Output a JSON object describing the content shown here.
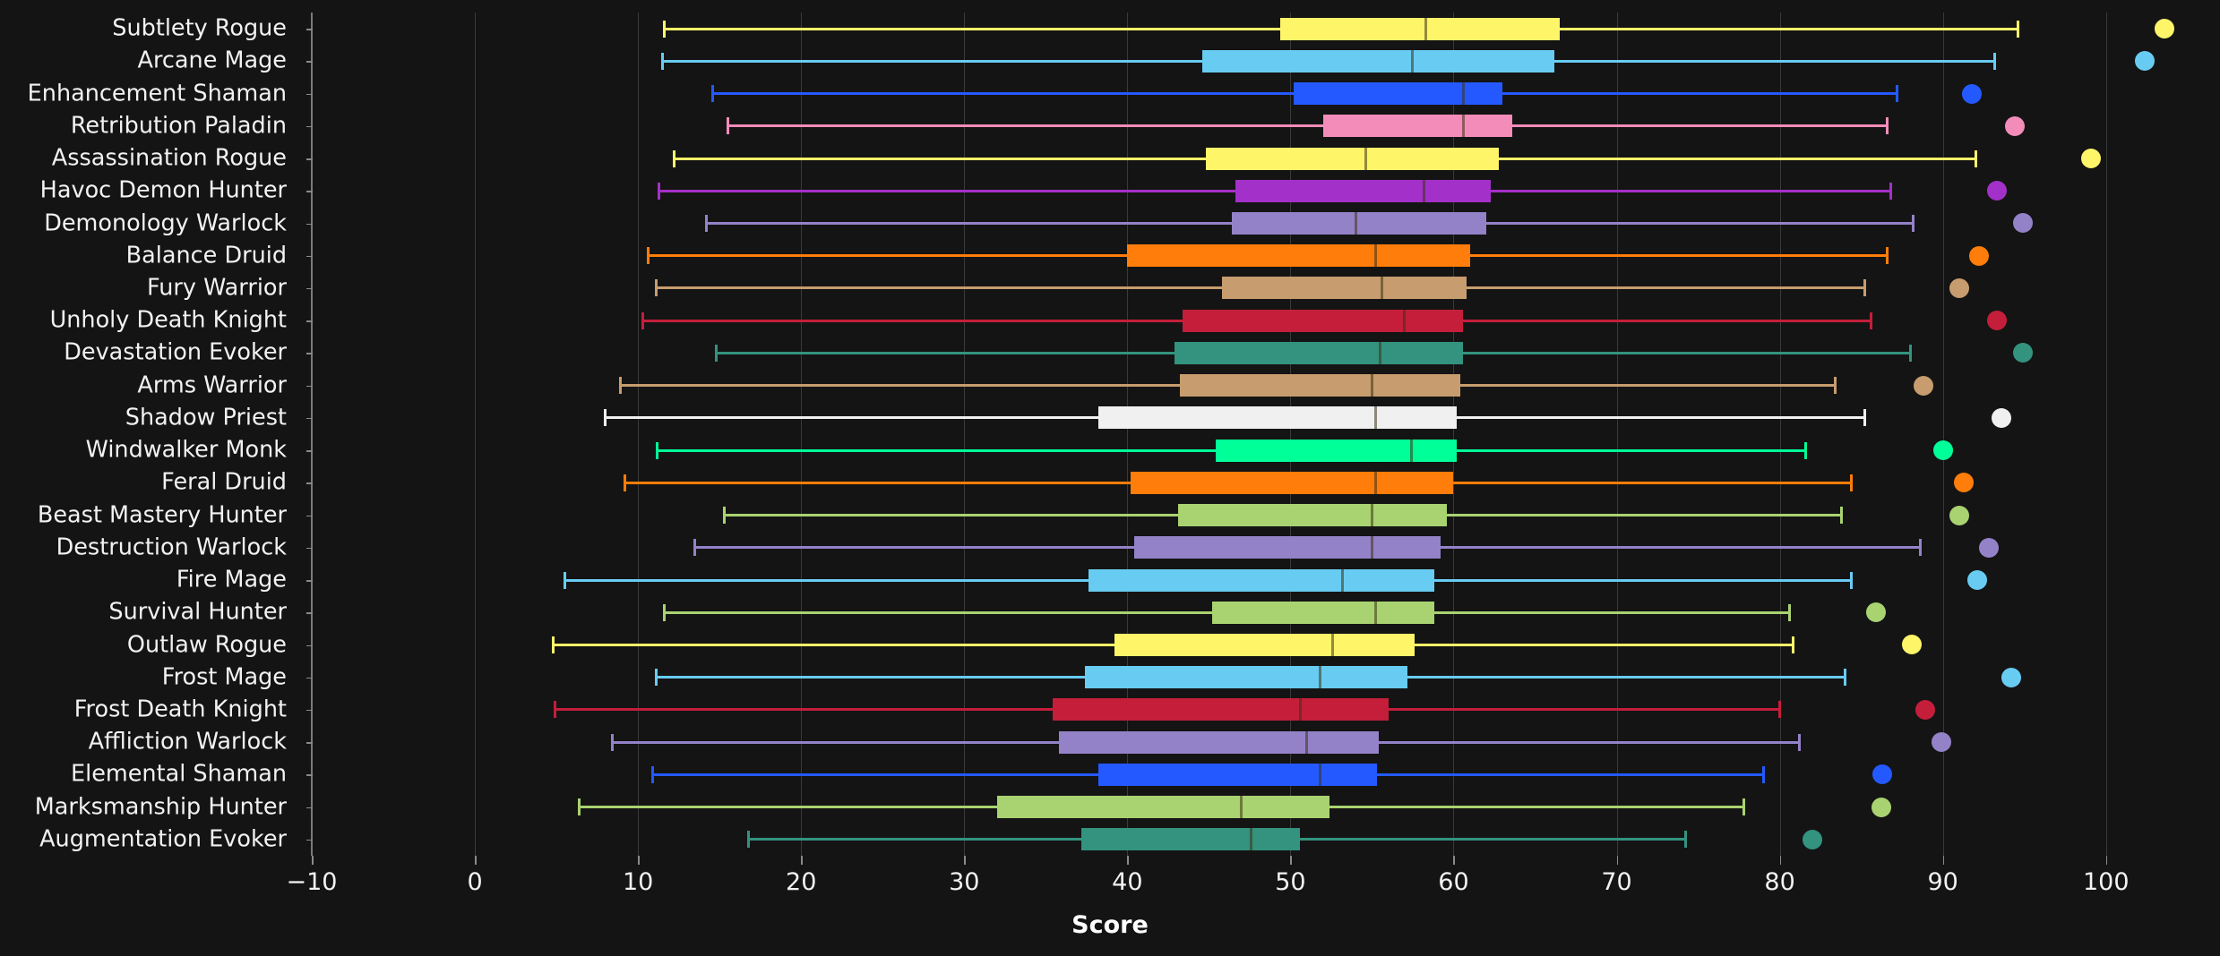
{
  "chart_data": {
    "type": "box",
    "title": "",
    "xlabel": "Score",
    "ylabel": "",
    "xlim": [
      -10,
      106
    ],
    "xticks": [
      -10,
      0,
      10,
      20,
      30,
      40,
      50,
      60,
      70,
      80,
      90,
      100
    ],
    "xtick_labels": [
      "−10",
      "0",
      "10",
      "20",
      "30",
      "40",
      "50",
      "60",
      "70",
      "80",
      "90",
      "100"
    ],
    "grid": "vertical",
    "legend": "none",
    "background": "#141414",
    "categories": [
      "Subtlety Rogue",
      "Arcane Mage",
      "Enhancement Shaman",
      "Retribution Paladin",
      "Assassination Rogue",
      "Havoc Demon Hunter",
      "Demonology Warlock",
      "Balance Druid",
      "Fury Warrior",
      "Unholy Death Knight",
      "Devastation Evoker",
      "Arms Warrior",
      "Shadow Priest",
      "Windwalker Monk",
      "Feral Druid",
      "Beast Mastery Hunter",
      "Destruction Warlock",
      "Fire Mage",
      "Survival Hunter",
      "Outlaw Rogue",
      "Frost Mage",
      "Frost Death Knight",
      "Affliction Warlock",
      "Elemental Shaman",
      "Marksmanship Hunter",
      "Augmentation Evoker"
    ],
    "boxes": [
      {
        "label": "Subtlety Rogue",
        "color": "#fff569",
        "whisker_low": 11.6,
        "q1": 49.4,
        "median": 58.3,
        "q3": 66.5,
        "whisker_high": 94.6,
        "outliers": [
          103.6
        ]
      },
      {
        "label": "Arcane Mage",
        "color": "#68ccf2",
        "whisker_low": 11.5,
        "q1": 44.6,
        "median": 57.5,
        "q3": 66.2,
        "whisker_high": 93.2,
        "outliers": [
          102.4
        ]
      },
      {
        "label": "Enhancement Shaman",
        "color": "#2459ff",
        "whisker_low": 14.6,
        "q1": 50.2,
        "median": 60.6,
        "q3": 63.0,
        "whisker_high": 87.2,
        "outliers": [
          91.8
        ]
      },
      {
        "label": "Retribution Paladin",
        "color": "#f48cba",
        "whisker_low": 15.5,
        "q1": 52.0,
        "median": 60.6,
        "q3": 63.6,
        "whisker_high": 86.6,
        "outliers": [
          94.4
        ]
      },
      {
        "label": "Assassination Rogue",
        "color": "#fff569",
        "whisker_low": 12.2,
        "q1": 44.8,
        "median": 54.6,
        "q3": 62.8,
        "whisker_high": 92.0,
        "outliers": [
          99.1
        ]
      },
      {
        "label": "Havoc Demon Hunter",
        "color": "#a330c9",
        "whisker_low": 11.3,
        "q1": 46.6,
        "median": 58.2,
        "q3": 62.3,
        "whisker_high": 86.8,
        "outliers": [
          93.3
        ]
      },
      {
        "label": "Demonology Warlock",
        "color": "#9482c9",
        "whisker_low": 14.2,
        "q1": 46.4,
        "median": 54.0,
        "q3": 62.0,
        "whisker_high": 88.2,
        "outliers": [
          94.9
        ]
      },
      {
        "label": "Balance Druid",
        "color": "#ff7d0a",
        "whisker_low": 10.6,
        "q1": 40.0,
        "median": 55.2,
        "q3": 61.0,
        "whisker_high": 86.6,
        "outliers": [
          92.2
        ]
      },
      {
        "label": "Fury Warrior",
        "color": "#c79c6e",
        "whisker_low": 11.1,
        "q1": 45.8,
        "median": 55.6,
        "q3": 60.8,
        "whisker_high": 85.2,
        "outliers": [
          91.0
        ]
      },
      {
        "label": "Unholy Death Knight",
        "color": "#c41e3b",
        "whisker_low": 10.3,
        "q1": 43.4,
        "median": 57.0,
        "q3": 60.6,
        "whisker_high": 85.6,
        "outliers": [
          93.3
        ]
      },
      {
        "label": "Devastation Evoker",
        "color": "#33937f",
        "whisker_low": 14.8,
        "q1": 42.9,
        "median": 55.5,
        "q3": 60.6,
        "whisker_high": 88.0,
        "outliers": [
          94.9
        ]
      },
      {
        "label": "Arms Warrior",
        "color": "#c79c6e",
        "whisker_low": 8.9,
        "q1": 43.2,
        "median": 55.0,
        "q3": 60.4,
        "whisker_high": 83.4,
        "outliers": [
          88.8
        ]
      },
      {
        "label": "Shadow Priest",
        "color": "#f0f0f0",
        "whisker_low": 8.0,
        "q1": 38.2,
        "median": 55.2,
        "q3": 60.2,
        "whisker_high": 85.2,
        "outliers": [
          93.6
        ]
      },
      {
        "label": "Windwalker Monk",
        "color": "#00ff98",
        "whisker_low": 11.2,
        "q1": 45.4,
        "median": 57.4,
        "q3": 60.2,
        "whisker_high": 81.6,
        "outliers": [
          90.0
        ]
      },
      {
        "label": "Feral Druid",
        "color": "#ff7d0a",
        "whisker_low": 9.2,
        "q1": 40.2,
        "median": 55.2,
        "q3": 60.0,
        "whisker_high": 84.4,
        "outliers": [
          91.3
        ]
      },
      {
        "label": "Beast Mastery Hunter",
        "color": "#a9d271",
        "whisker_low": 15.3,
        "q1": 43.1,
        "median": 55.0,
        "q3": 59.6,
        "whisker_high": 83.8,
        "outliers": [
          91.0
        ]
      },
      {
        "label": "Destruction Warlock",
        "color": "#9482c9",
        "whisker_low": 13.5,
        "q1": 40.4,
        "median": 55.0,
        "q3": 59.2,
        "whisker_high": 88.6,
        "outliers": [
          92.8
        ]
      },
      {
        "label": "Fire Mage",
        "color": "#68ccf2",
        "whisker_low": 5.5,
        "q1": 37.6,
        "median": 53.2,
        "q3": 58.8,
        "whisker_high": 84.4,
        "outliers": [
          92.1
        ]
      },
      {
        "label": "Survival Hunter",
        "color": "#a9d271",
        "whisker_low": 11.6,
        "q1": 45.2,
        "median": 55.2,
        "q3": 58.8,
        "whisker_high": 80.6,
        "outliers": [
          85.9
        ]
      },
      {
        "label": "Outlaw Rogue",
        "color": "#fff569",
        "whisker_low": 4.8,
        "q1": 39.2,
        "median": 52.6,
        "q3": 57.6,
        "whisker_high": 80.8,
        "outliers": [
          88.1
        ]
      },
      {
        "label": "Frost Mage",
        "color": "#68ccf2",
        "whisker_low": 11.1,
        "q1": 37.4,
        "median": 51.8,
        "q3": 57.2,
        "whisker_high": 84.0,
        "outliers": [
          94.2
        ]
      },
      {
        "label": "Frost Death Knight",
        "color": "#c41e3b",
        "whisker_low": 4.9,
        "q1": 35.4,
        "median": 50.6,
        "q3": 56.0,
        "whisker_high": 80.0,
        "outliers": [
          88.9
        ]
      },
      {
        "label": "Affliction Warlock",
        "color": "#9482c9",
        "whisker_low": 8.4,
        "q1": 35.8,
        "median": 51.0,
        "q3": 55.4,
        "whisker_high": 81.2,
        "outliers": [
          89.9
        ]
      },
      {
        "label": "Elemental Shaman",
        "color": "#2459ff",
        "whisker_low": 10.9,
        "q1": 38.2,
        "median": 51.8,
        "q3": 55.3,
        "whisker_high": 79.0,
        "outliers": [
          86.3
        ]
      },
      {
        "label": "Marksmanship Hunter",
        "color": "#a9d271",
        "whisker_low": 6.4,
        "q1": 32.0,
        "median": 47.0,
        "q3": 52.4,
        "whisker_high": 77.8,
        "outliers": [
          86.2
        ]
      },
      {
        "label": "Augmentation Evoker",
        "color": "#33937f",
        "whisker_low": 16.8,
        "q1": 37.2,
        "median": 47.6,
        "q3": 50.6,
        "whisker_high": 74.2,
        "outliers": [
          82.0
        ]
      }
    ]
  }
}
